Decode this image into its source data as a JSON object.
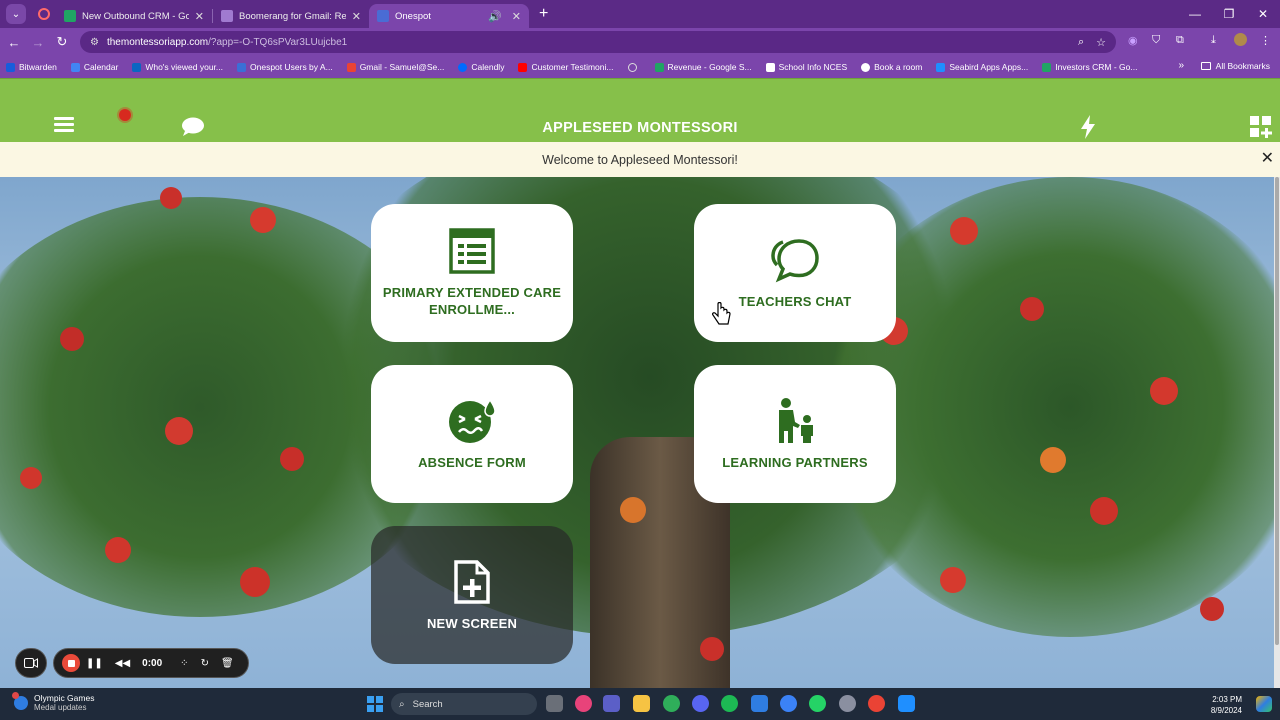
{
  "browser": {
    "tabs": [
      {
        "title": "New Outbound CRM - Google",
        "favicon_color": "#20a464",
        "active": false
      },
      {
        "title": "Boomerang for Gmail: Recurrin",
        "favicon_color": "#6b3fa0",
        "active": false
      },
      {
        "title": "Onespot",
        "favicon_color": "#4a6cd4",
        "active": true
      }
    ],
    "url": {
      "host": "themontessoriapp.com",
      "path": "/?app=-O-TQ6sPVar3LUujcbe1"
    },
    "bookmarks": [
      {
        "label": "Bitwarden",
        "color": "#175ddc"
      },
      {
        "label": "Calendar",
        "color": "#4285f4"
      },
      {
        "label": "Who's viewed your...",
        "color": "#0a66c2"
      },
      {
        "label": "Onespot Users by A...",
        "color": "#3b6fd6"
      },
      {
        "label": "Gmail - Samuel@Se...",
        "color": "#ea4335"
      },
      {
        "label": "Calendly",
        "color": "#006bff"
      },
      {
        "label": "Customer Testimoni...",
        "color": "#ff0000"
      },
      {
        "label": "Revenue - Google S...",
        "color": "#20a464"
      },
      {
        "label": "School Info NCES",
        "color": "#ffffff"
      },
      {
        "label": "Book a room",
        "color": "#ffffff"
      },
      {
        "label": "Seabird Apps Apps...",
        "color": "#1f8fff"
      },
      {
        "label": "Investors CRM - Go...",
        "color": "#20a464"
      }
    ],
    "all_bookmarks": "All Bookmarks"
  },
  "app": {
    "title": "APPLESEED MONTESSORI",
    "welcome": "Welcome to Appleseed Montessori!",
    "cards": [
      {
        "label_line1": "PRIMARY EXTENDED CARE",
        "label_line2": "ENROLLME...",
        "icon": "form-list-icon"
      },
      {
        "label_line1": "TEACHERS CHAT",
        "label_line2": "",
        "icon": "chat-bubbles-icon"
      },
      {
        "label_line1": "ABSENCE FORM",
        "label_line2": "",
        "icon": "sick-face-icon"
      },
      {
        "label_line1": "LEARNING PARTNERS",
        "label_line2": "",
        "icon": "parent-child-icon"
      },
      {
        "label_line1": "NEW SCREEN",
        "label_line2": "",
        "icon": "new-file-icon"
      }
    ],
    "colors": {
      "header": "#86c04a",
      "card_text": "#2e6d20",
      "welcome_bg": "#fbf7e3"
    }
  },
  "recorder": {
    "time": "0:00"
  },
  "taskbar": {
    "news_title": "Olympic Games",
    "news_subtitle": "Medal updates",
    "search_placeholder": "Search",
    "time": "2:03 PM",
    "date": "8/9/2024"
  }
}
